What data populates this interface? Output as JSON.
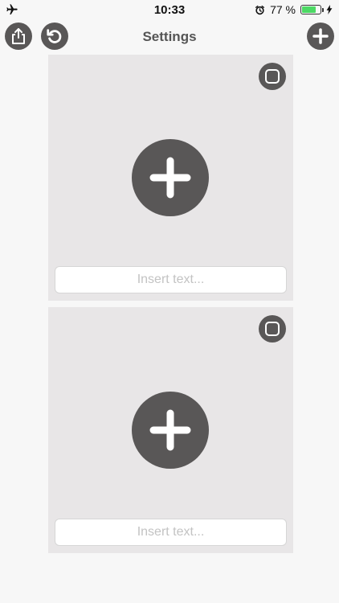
{
  "status_bar": {
    "time": "10:33",
    "battery_percent_text": "77 %",
    "battery_level": 0.77,
    "battery_color": "#4cd964",
    "left_icon": "airplane-icon",
    "right_icons": [
      "alarm-icon",
      "battery-icon",
      "charging-bolt-icon"
    ]
  },
  "nav_bar": {
    "title": "Settings",
    "left_buttons": [
      "share-icon",
      "refresh-icon"
    ],
    "right_buttons": [
      "plus-icon"
    ]
  },
  "cards": [
    {
      "text_value": "",
      "text_placeholder": "Insert text...",
      "checkbox_icon": "checkbox-icon",
      "add_icon": "plus-icon"
    },
    {
      "text_value": "",
      "text_placeholder": "Insert text...",
      "checkbox_icon": "checkbox-icon",
      "add_icon": "plus-icon"
    }
  ],
  "colors": {
    "button_fill": "#595757",
    "card_background": "#e8e6e7",
    "page_background": "#f7f7f7"
  }
}
